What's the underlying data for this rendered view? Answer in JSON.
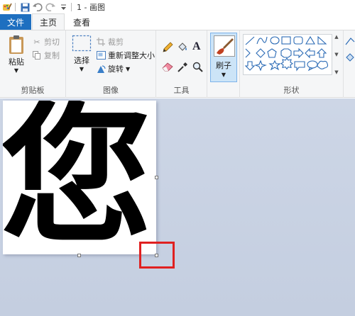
{
  "window": {
    "title": "1 - 画图"
  },
  "tabs": {
    "file": "文件",
    "home": "主页",
    "view": "查看"
  },
  "clipboard": {
    "paste": "粘贴",
    "cut": "剪切",
    "copy": "复制",
    "group": "剪贴板"
  },
  "image": {
    "select": "选择",
    "crop": "裁剪",
    "resize": "重新调整大小",
    "rotate": "旋转",
    "group": "图像"
  },
  "tools": {
    "group": "工具",
    "text_icon_glyph": "A"
  },
  "brushes": {
    "label": "刷子"
  },
  "shapes": {
    "group": "形状"
  },
  "canvas": {
    "character": "您"
  },
  "colors": {
    "file_tab": "#1e6fc0",
    "highlight": "#e02020",
    "workspace": "#c9d3e4",
    "brush_active": "#cce4f7"
  }
}
